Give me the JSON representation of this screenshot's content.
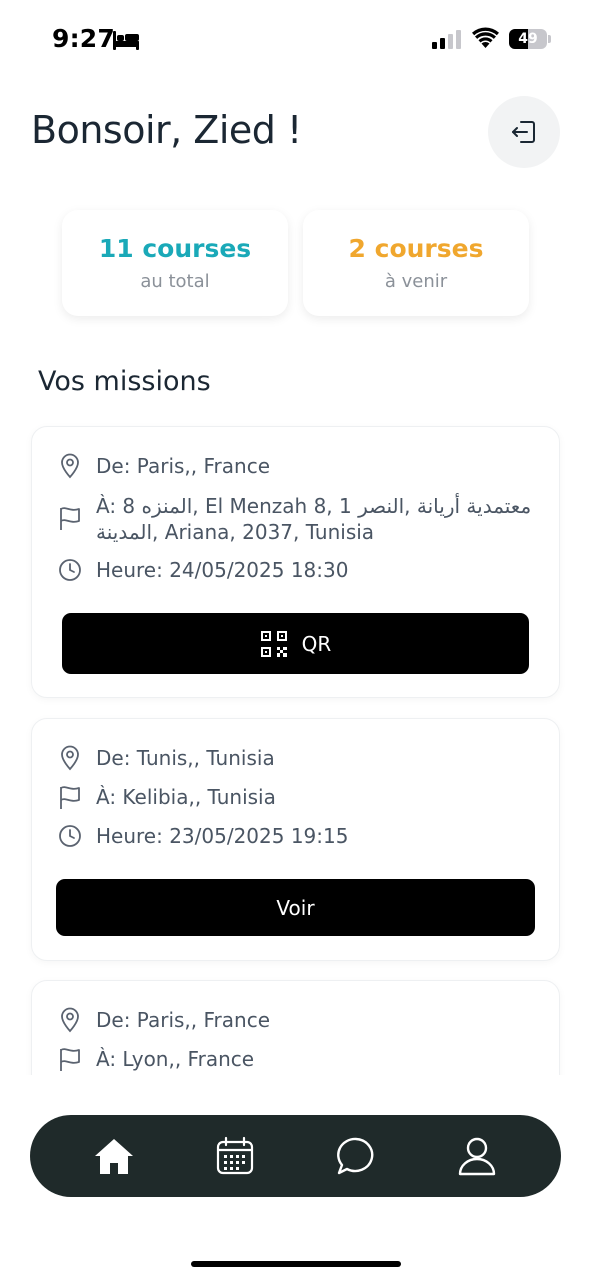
{
  "status_bar": {
    "time": "9:27",
    "battery": "49",
    "battery_level": 0.49
  },
  "header": {
    "greeting": "Bonsoir, Zied !"
  },
  "stats": [
    {
      "value": "11 courses",
      "label": "au total",
      "color": "#1aa9b8"
    },
    {
      "value": "2 courses",
      "label": "à venir",
      "color": "#f0a72e"
    }
  ],
  "missions_title": "Vos missions",
  "missions": [
    {
      "from": "De: Paris,, France",
      "to_line1": "À: 8 المنزه, El Menzah 8, معتمدية أريانة ,النصر 1",
      "to_line2": "المدينة, Ariana, 2037, Tunisia",
      "time": "Heure: 24/05/2025 18:30",
      "button": "QR"
    },
    {
      "from": "De: Tunis,, Tunisia",
      "to": "À: Kelibia,, Tunisia",
      "time": "Heure: 23/05/2025 19:15",
      "button": "Voir"
    },
    {
      "from": "De: Paris,, France",
      "to": "À: Lyon,, France"
    }
  ],
  "tabbar": {
    "items": [
      "home-icon",
      "calendar-icon",
      "chat-icon",
      "profile-icon"
    ]
  }
}
